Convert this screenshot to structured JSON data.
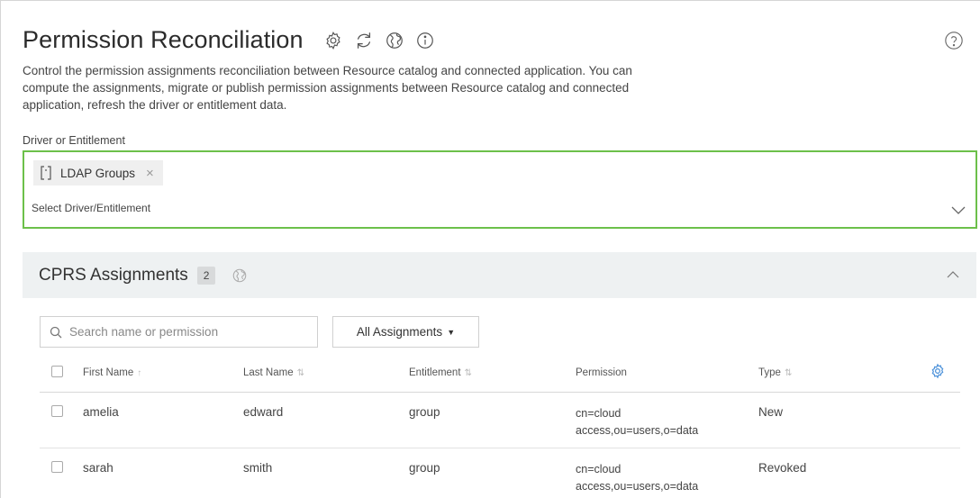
{
  "page": {
    "title": "Permission Reconciliation",
    "description": "Control the permission assignments reconciliation between Resource catalog and connected application. You can compute the assignments, migrate or publish permission assignments between Resource catalog and connected application, refresh the driver or entitlement data.",
    "title_icons": [
      "settings-icon",
      "refresh-icon",
      "globe-icon",
      "info-icon"
    ],
    "help_icon": "help-icon"
  },
  "driver_field": {
    "label": "Driver or Entitlement",
    "selected_chip": "LDAP Groups",
    "chip_remove": "×",
    "placeholder": "Select Driver/Entitlement"
  },
  "panel": {
    "title": "CPRS Assignments",
    "count": "2"
  },
  "search": {
    "placeholder": "Search name or permission"
  },
  "filter": {
    "label": "All Assignments"
  },
  "table": {
    "columns": [
      "First Name",
      "Last Name",
      "Entitlement",
      "Permission",
      "Type"
    ],
    "rows": [
      {
        "first_name": "amelia",
        "last_name": "edward",
        "entitlement": "group",
        "permission_line1": "cn=cloud",
        "permission_line2": "access,ou=users,o=data",
        "type": "New"
      },
      {
        "first_name": "sarah",
        "last_name": "smith",
        "entitlement": "group",
        "permission_line1": "cn=cloud",
        "permission_line2": "access,ou=users,o=data",
        "type": "Revoked"
      }
    ]
  },
  "colors": {
    "accent_green": "#6cc04a",
    "settings_blue": "#4a90d9"
  }
}
